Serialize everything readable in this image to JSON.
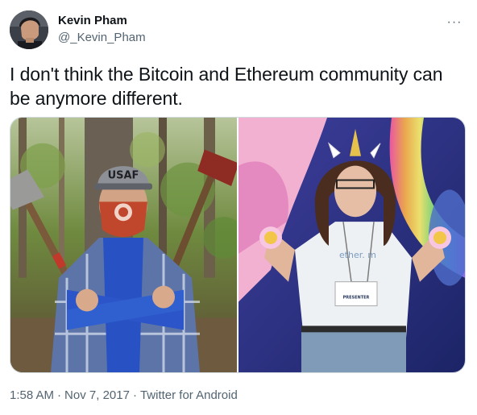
{
  "author": {
    "display_name": "Kevin Pham",
    "handle": "@_Kevin_Pham"
  },
  "more_icon": "more-horizontal-icon",
  "tweet": {
    "text": "I don't think the Bitcoin and Ethereum community can be anymore different."
  },
  "media": {
    "left_photo": {
      "cap_text": "USAF",
      "subject": "man in flannel shirt and cap holding two axes in forest"
    },
    "right_photo": {
      "shirt_text": "ether. m",
      "badge_text": "PRESENTER",
      "subject": "man with unicorn horn headband in front of rainbow backdrop"
    }
  },
  "meta": {
    "time": "1:58 AM",
    "separator": "·",
    "date": "Nov 7, 2017",
    "source": "Twitter for Android"
  },
  "colors": {
    "text_primary": "#0f1419",
    "text_secondary": "#536471",
    "border": "#cfd9de"
  }
}
